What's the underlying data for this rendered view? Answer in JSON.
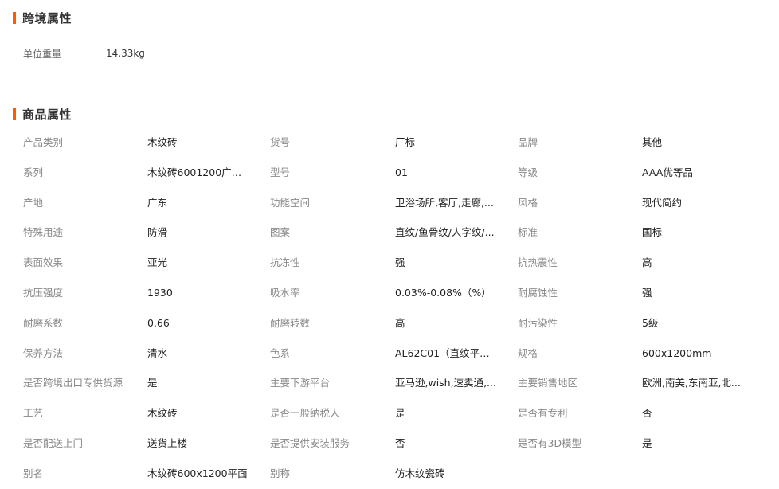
{
  "cross_border": {
    "title": "跨境属性",
    "items": [
      {
        "label": "单位重量",
        "value": "14.33kg"
      }
    ]
  },
  "product_attributes": {
    "title": "商品属性",
    "rows": [
      [
        {
          "label": "产品类别",
          "value": "木纹砖"
        },
        {
          "label": "货号",
          "value": "厂标"
        },
        {
          "label": "品牌",
          "value": "其他"
        }
      ],
      [
        {
          "label": "系列",
          "value": "木纹砖6001200广东..."
        },
        {
          "label": "型号",
          "value": "01"
        },
        {
          "label": "等级",
          "value": "AAA优等品"
        }
      ],
      [
        {
          "label": "产地",
          "value": "广东"
        },
        {
          "label": "功能空间",
          "value": "卫浴场所,客厅,走廊,..."
        },
        {
          "label": "风格",
          "value": "现代简约"
        }
      ],
      [
        {
          "label": "特殊用途",
          "value": "防滑"
        },
        {
          "label": "图案",
          "value": "直纹/鱼骨纹/人字纹/..."
        },
        {
          "label": "标准",
          "value": "国标"
        }
      ],
      [
        {
          "label": "表面效果",
          "value": "亚光"
        },
        {
          "label": "抗冻性",
          "value": "强"
        },
        {
          "label": "抗热震性",
          "value": "高"
        }
      ],
      [
        {
          "label": "抗压强度",
          "value": "1930"
        },
        {
          "label": "吸水率",
          "value": "0.03%-0.08%（%）"
        },
        {
          "label": "耐腐蚀性",
          "value": "强"
        }
      ],
      [
        {
          "label": "耐磨系数",
          "value": "0.66"
        },
        {
          "label": "耐磨转数",
          "value": "高"
        },
        {
          "label": "耐污染性",
          "value": "5级"
        }
      ],
      [
        {
          "label": "保养方法",
          "value": "清水"
        },
        {
          "label": "色系",
          "value": "AL62C01（直纹平面..."
        },
        {
          "label": "规格",
          "value": "600x1200mm"
        }
      ],
      [
        {
          "label": "是否跨境出口专供货源",
          "value": "是"
        },
        {
          "label": "主要下游平台",
          "value": "亚马逊,wish,速卖通,..."
        },
        {
          "label": "主要销售地区",
          "value": "欧洲,南美,东南亚,北..."
        }
      ],
      [
        {
          "label": "工艺",
          "value": "木纹砖"
        },
        {
          "label": "是否一般纳税人",
          "value": "是"
        },
        {
          "label": "是否有专利",
          "value": "否"
        }
      ],
      [
        {
          "label": "是否配送上门",
          "value": "送货上楼"
        },
        {
          "label": "是否提供安装服务",
          "value": "否"
        },
        {
          "label": "是否有3D模型",
          "value": "是"
        }
      ],
      [
        {
          "label": "别名",
          "value": "木纹砖600x1200平面"
        },
        {
          "label": "别称",
          "value": "仿木纹瓷砖"
        }
      ]
    ]
  },
  "colors": {
    "accent": "#ff5a00",
    "label": "#888888",
    "value": "#222222"
  }
}
